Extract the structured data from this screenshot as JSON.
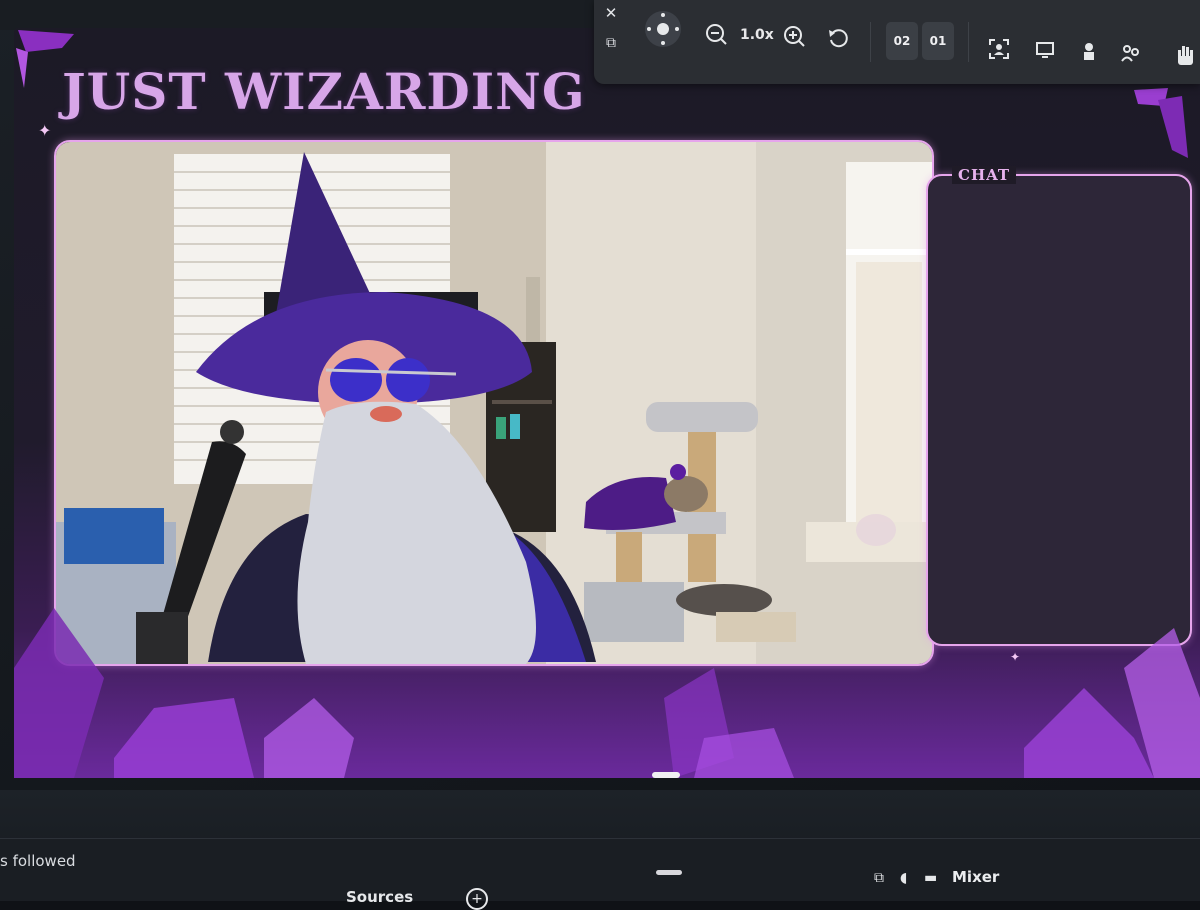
{
  "stream": {
    "title": "JUST WIZARDING",
    "chat_label": "CHAT",
    "colors": {
      "accent": "#e6a5ec",
      "crystal": "#a23fd3",
      "background": "#1f1b27"
    }
  },
  "toolbar": {
    "zoom_level": "1.0x",
    "scene_buttons": [
      "02",
      "01"
    ],
    "icons": [
      "close-icon",
      "minimize-icon",
      "move-icon",
      "zoom-out-icon",
      "zoom-in-icon",
      "reset-icon",
      "face-track-icon",
      "screen-icon",
      "person-icon",
      "group-icon",
      "hand-icon"
    ]
  },
  "bottom": {
    "activity_text": "s followed",
    "sources_label": "Sources",
    "mixer_label": "Mixer"
  }
}
